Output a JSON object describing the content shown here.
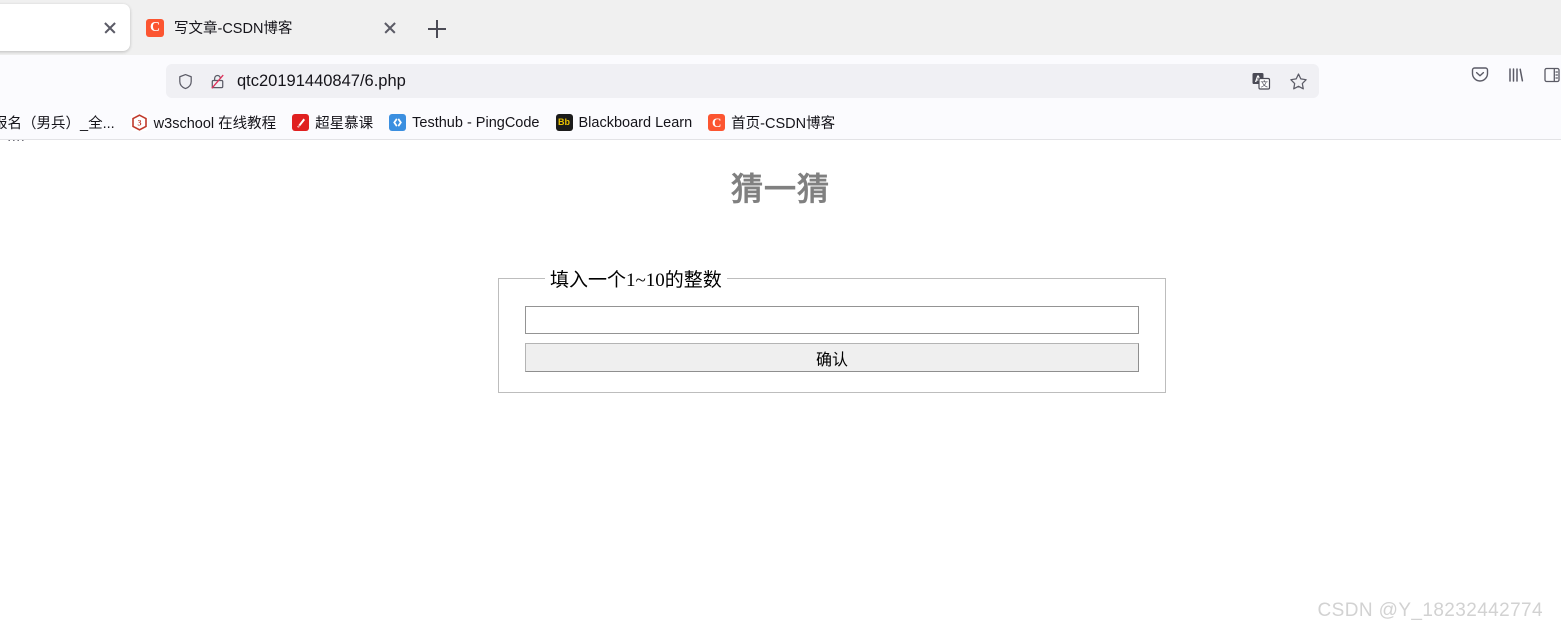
{
  "window": {
    "tabs": [
      {
        "title": "",
        "favicon": "blank-favicon",
        "active": true,
        "close_label": "×"
      },
      {
        "title": "写文章-CSDN博客",
        "favicon": "csdn-icon",
        "favicon_letter": "C",
        "active": false,
        "close_label": "×"
      }
    ],
    "new_tab_label": "+"
  },
  "nav": {
    "home_icon": "home-icon",
    "url": "qtc20191440847/6.php",
    "shield_icon": "shield-icon",
    "lock_icon": "lock-crossed-icon",
    "translate_icon": "translate-icon",
    "bookmark_star_icon": "star-icon",
    "pocket_icon": "pocket-icon",
    "library_icon": "library-icon",
    "sidebar_icon": "sidebar-icon"
  },
  "bookmarks": [
    {
      "label": "报名（男兵）_全...",
      "icon": "generic-bookmark-icon",
      "icon_letter": ""
    },
    {
      "label": "w3school 在线教程",
      "icon": "w3school-icon",
      "icon_letter": "3"
    },
    {
      "label": "超星慕课",
      "icon": "chaoxing-icon",
      "icon_letter": ""
    },
    {
      "label": "Testhub - PingCode",
      "icon": "testhub-icon",
      "icon_letter": ""
    },
    {
      "label": "Blackboard Learn",
      "icon": "blackboard-icon",
      "icon_letter": "Bb"
    },
    {
      "label": "首页-CSDN博客",
      "icon": "csdn-icon",
      "icon_letter": "C"
    }
  ],
  "page": {
    "title": "猜一猜",
    "fieldset_legend": "填入一个1~10的整数",
    "input_value": "",
    "input_placeholder": "",
    "submit_label": "确认"
  },
  "watermark": "CSDN @Y_18232442774",
  "colors": {
    "csdn_orange": "#fc5531",
    "title_gray": "#808080",
    "chrome_bg": "#f0f0f4",
    "watermark_gray": "#d2d2d2"
  }
}
